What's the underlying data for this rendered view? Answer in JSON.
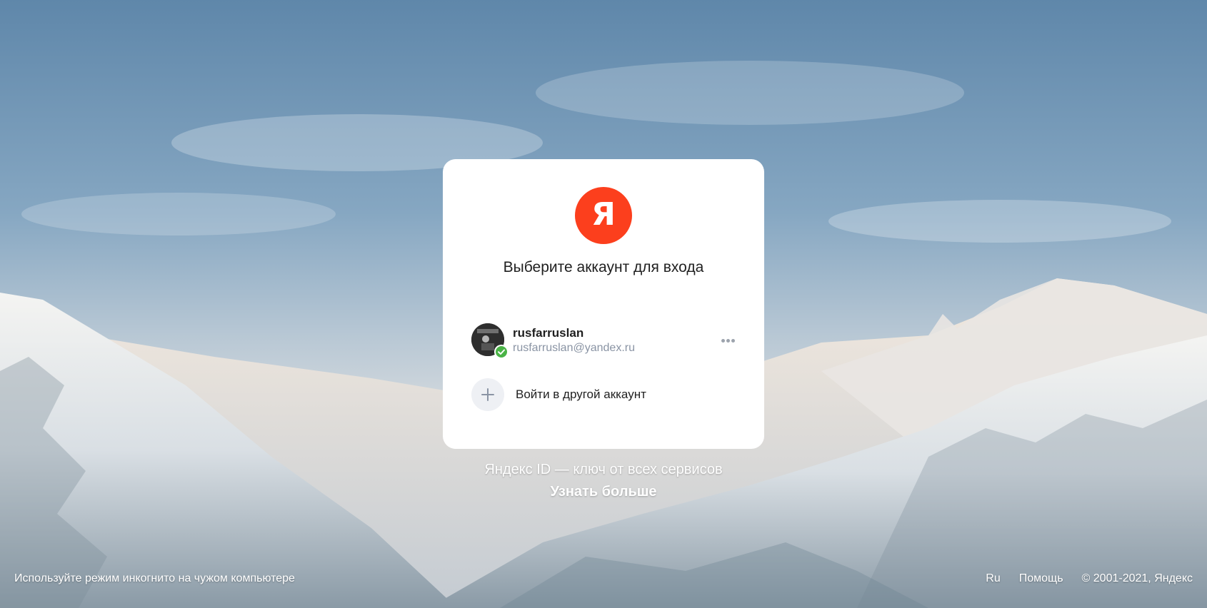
{
  "logo": {
    "letter": "Я",
    "color": "#fc3f1d"
  },
  "card": {
    "title": "Выберите аккаунт для входа"
  },
  "account": {
    "login": "rusfarruslan",
    "email": "rusfarruslan@yandex.ru",
    "verified_badge_color": "#4ab346",
    "more_icon": "more-dots-icon"
  },
  "add_account": {
    "label": "Войти в другой аккаунт",
    "icon": "plus-icon"
  },
  "promo": {
    "tagline": "Яндекс ID — ключ от всех сервисов",
    "learn_more": "Узнать больше"
  },
  "footer": {
    "incognito_hint": "Используйте режим инкогнито на чужом компьютере",
    "language": "Ru",
    "help": "Помощь",
    "copyright": "© 2001-2021, Яндекс"
  }
}
